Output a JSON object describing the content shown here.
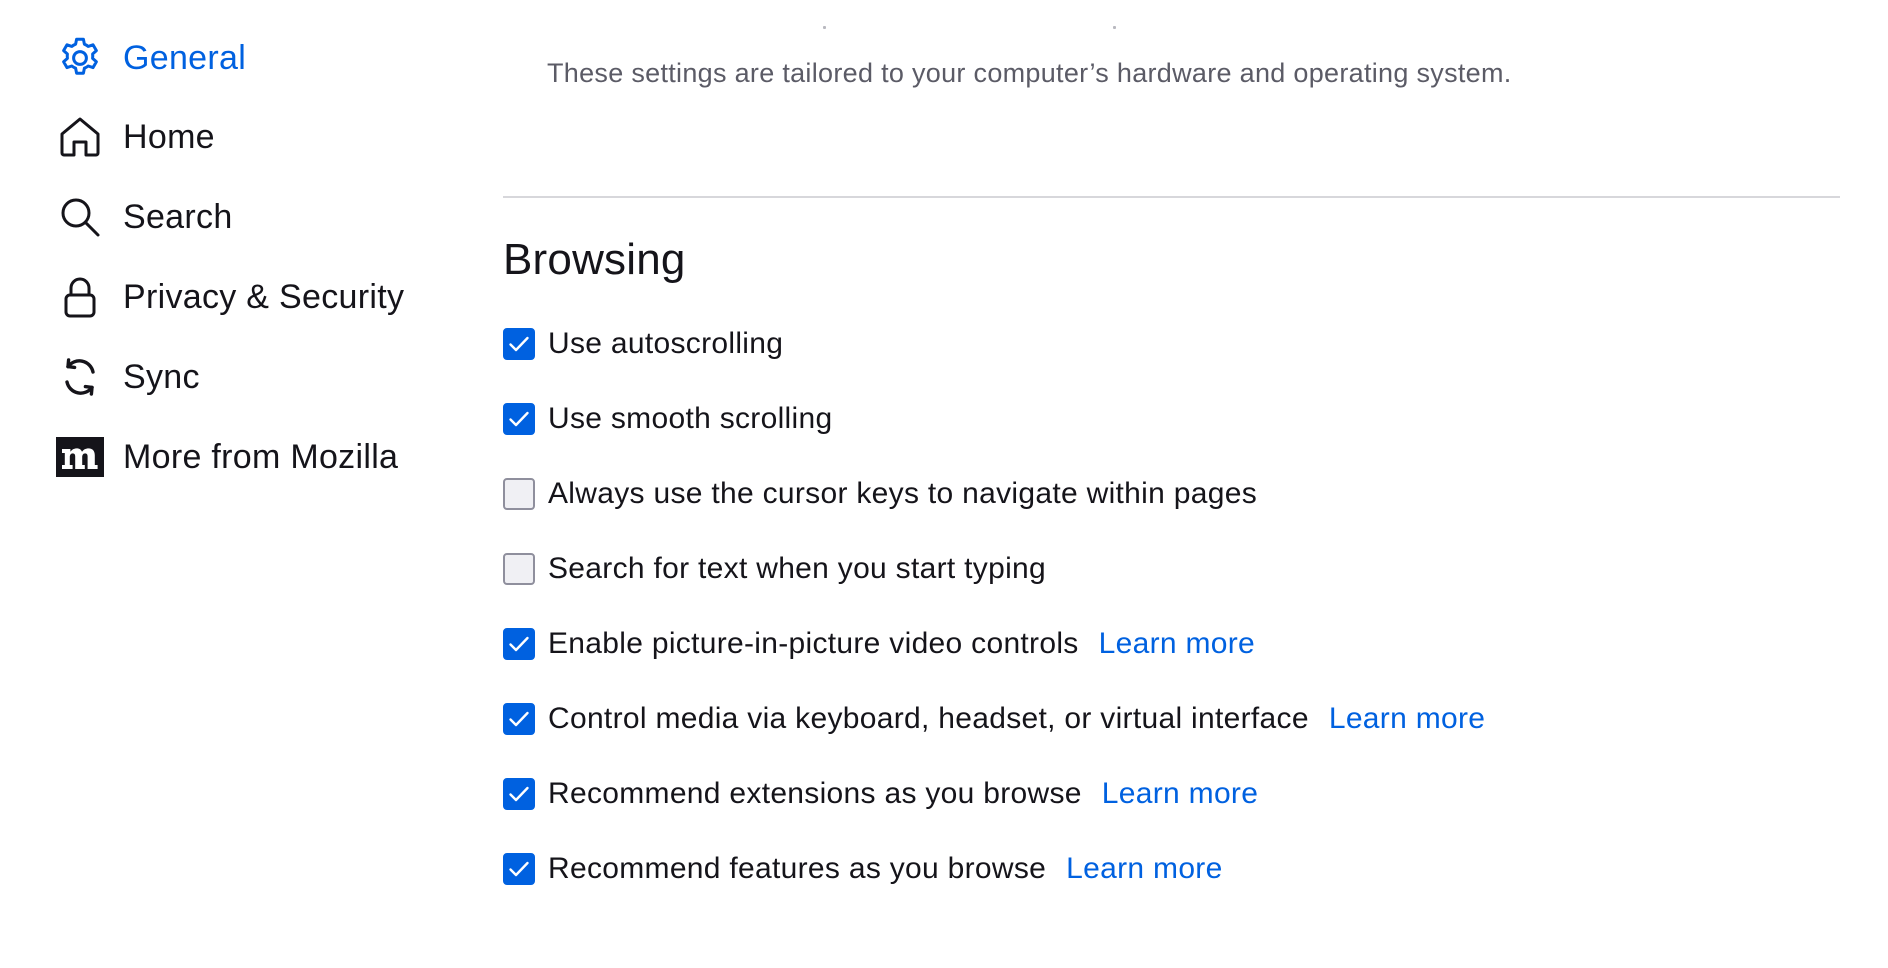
{
  "sidebar": {
    "items": [
      {
        "label": "General",
        "icon": "gear-icon",
        "selected": true
      },
      {
        "label": "Home",
        "icon": "home-icon",
        "selected": false
      },
      {
        "label": "Search",
        "icon": "search-icon",
        "selected": false
      },
      {
        "label": "Privacy & Security",
        "icon": "lock-icon",
        "selected": false
      },
      {
        "label": "Sync",
        "icon": "sync-icon",
        "selected": false
      },
      {
        "label": "More from Mozilla",
        "icon": "mozilla-logo-icon",
        "selected": false
      }
    ]
  },
  "main": {
    "hint": "These settings are tailored to your computer’s hardware and operating system.",
    "browsing": {
      "title": "Browsing",
      "options": [
        {
          "label": "Use autoscrolling",
          "checked": true,
          "learn_more": null
        },
        {
          "label": "Use smooth scrolling",
          "checked": true,
          "learn_more": null
        },
        {
          "label": "Always use the cursor keys to navigate within pages",
          "checked": false,
          "learn_more": null
        },
        {
          "label": "Search for text when you start typing",
          "checked": false,
          "learn_more": null
        },
        {
          "label": "Enable picture-in-picture video controls",
          "checked": true,
          "learn_more": "Learn more"
        },
        {
          "label": "Control media via keyboard, headset, or virtual interface",
          "checked": true,
          "learn_more": "Learn more"
        },
        {
          "label": "Recommend extensions as you browse",
          "checked": true,
          "learn_more": "Learn more"
        },
        {
          "label": "Recommend features as you browse",
          "checked": true,
          "learn_more": "Learn more"
        }
      ]
    }
  },
  "colors": {
    "accent": "#0061e0",
    "text": "#15141a",
    "secondary_text": "#5b5b66",
    "divider": "#d7d7db"
  }
}
